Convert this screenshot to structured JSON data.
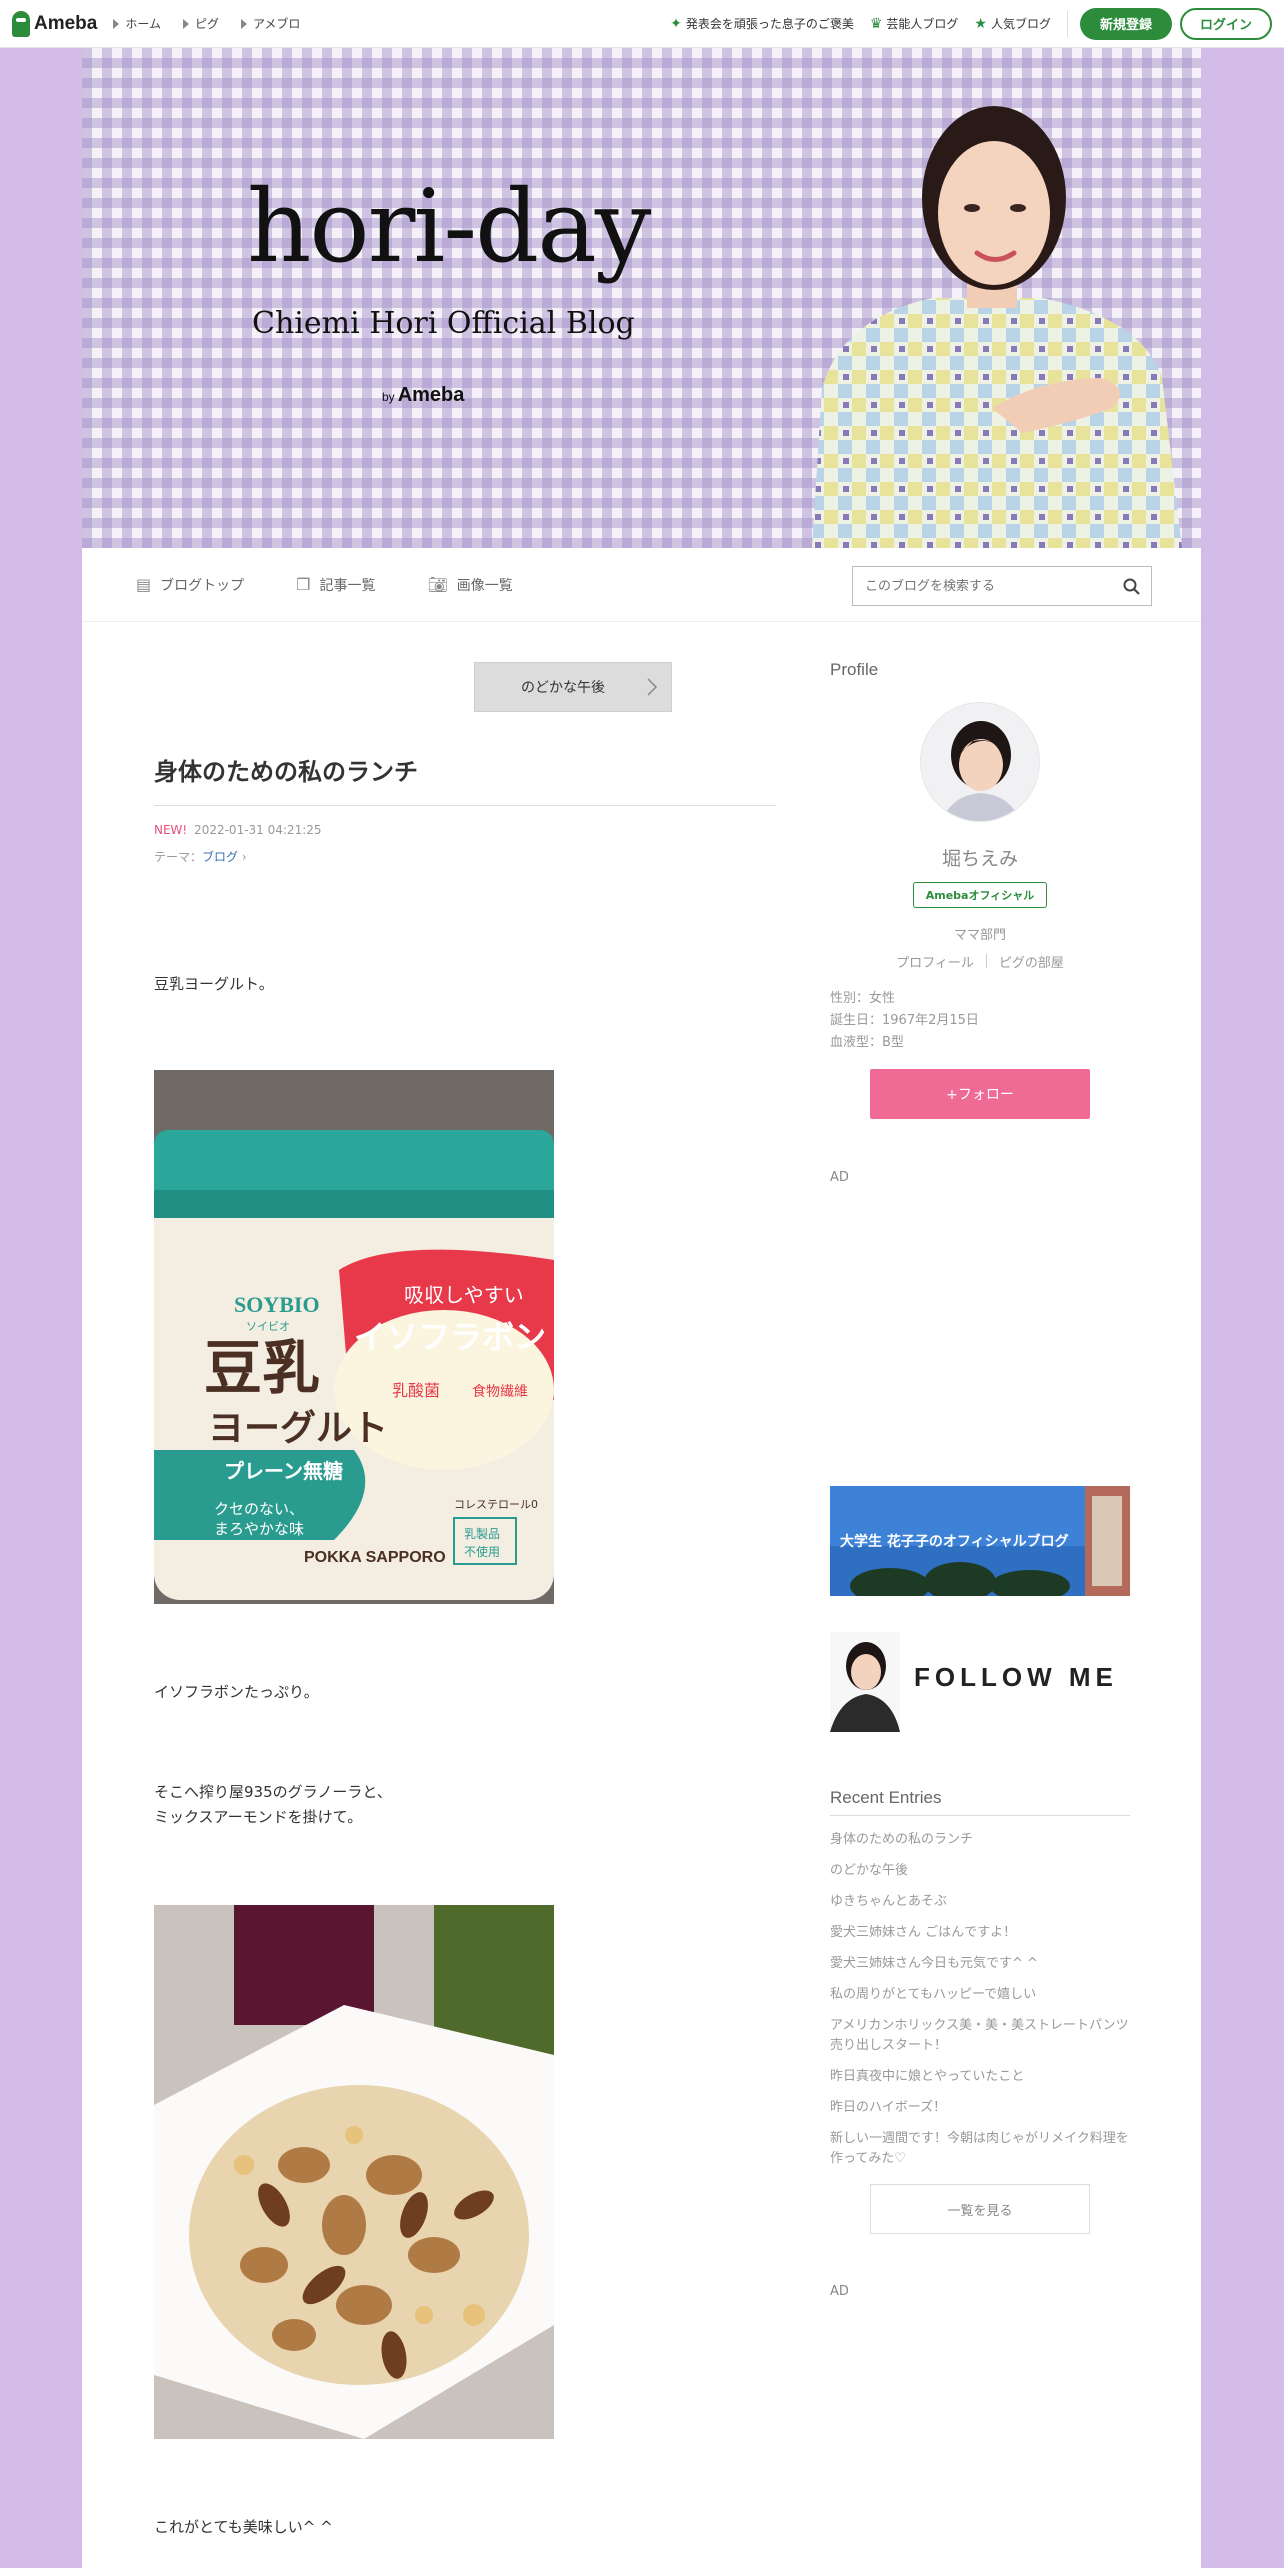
{
  "global_header": {
    "logo": "Ameba",
    "nav": [
      "ホーム",
      "ピグ",
      "アメブロ"
    ],
    "links": [
      {
        "icon": "sparkle-icon",
        "label": "発表会を頑張った息子のご褒美"
      },
      {
        "icon": "crown-icon",
        "label": "芸能人ブログ"
      },
      {
        "icon": "star-icon",
        "label": "人気ブログ"
      }
    ],
    "register_label": "新規登録",
    "login_label": "ログイン"
  },
  "banner": {
    "title": "hori-day",
    "subtitle": "Chiemi Hori Official Blog",
    "by": "by",
    "brand": "Ameba"
  },
  "blog_nav": {
    "items": [
      {
        "icon": "document-icon",
        "label": "ブログトップ"
      },
      {
        "icon": "copy-icon",
        "label": "記事一覧"
      },
      {
        "icon": "camera-icon",
        "label": "画像一覧"
      }
    ],
    "search_placeholder": "このブログを検索する"
  },
  "entry": {
    "prev_title": "のどかな午後",
    "title": "身体のための私のランチ",
    "new_label": "NEW!",
    "datetime": "2022-01-31 04:21:25",
    "theme_prefix": "テーマ：",
    "theme": "ブログ",
    "paragraphs": [
      "豆乳ヨーグルト。",
      "イソフラボンたっぷり。",
      "そこへ搾り屋935のグラノーラと、",
      "ミックスアーモンドを掛けて。",
      "これがとても美味しい^ ^"
    ],
    "photo1": {
      "brand": "SOYBIO",
      "brand_kana": "ソイビオ",
      "name1": "豆乳",
      "name2": "ヨーグルト",
      "badge1": "吸収しやすい",
      "badge2": "イソフラボン",
      "badge3": "乳酸菌",
      "badge4": "食物繊維",
      "plain": "プレーン無糖",
      "taste1": "クセのない、",
      "taste2": "まろやかな味",
      "maker": "POKKA SAPPORO",
      "cholesterol": "コレステロール0",
      "dairy1": "乳製品",
      "dairy2": "不使用"
    }
  },
  "sidebar": {
    "profile_heading": "Profile",
    "name": "堀ちえみ",
    "official_badge": "Amebaオフィシャル",
    "category": "ママ部門",
    "links": [
      "プロフィール",
      "ピグの部屋"
    ],
    "info": [
      "性別：女性",
      "誕生日：1967年2月15日",
      "血液型：B型"
    ],
    "follow_label": "+フォロー",
    "ad_label": "AD",
    "banner1_text": "大学生 花子子のオフィシャルブログ",
    "follow_me": "FOLLOW ME",
    "recent_heading": "Recent Entries",
    "recent": [
      "身体のための私のランチ",
      "のどかな午後",
      "ゆきちゃんとあそぶ",
      "愛犬三姉妹さん ごはんですよ！",
      "愛犬三姉妹さん今日も元気です^ ^",
      "私の周りがとてもハッピーで嬉しい",
      "アメリカンホリックス美・美・美ストレートパンツ売り出しスタート！",
      "昨日真夜中に娘とやっていたこと",
      "昨日のハイボーズ！",
      "新しい一週間です！今朝は肉じゃがリメイク料理を作ってみた♡"
    ],
    "more_label": "一覧を見る"
  }
}
